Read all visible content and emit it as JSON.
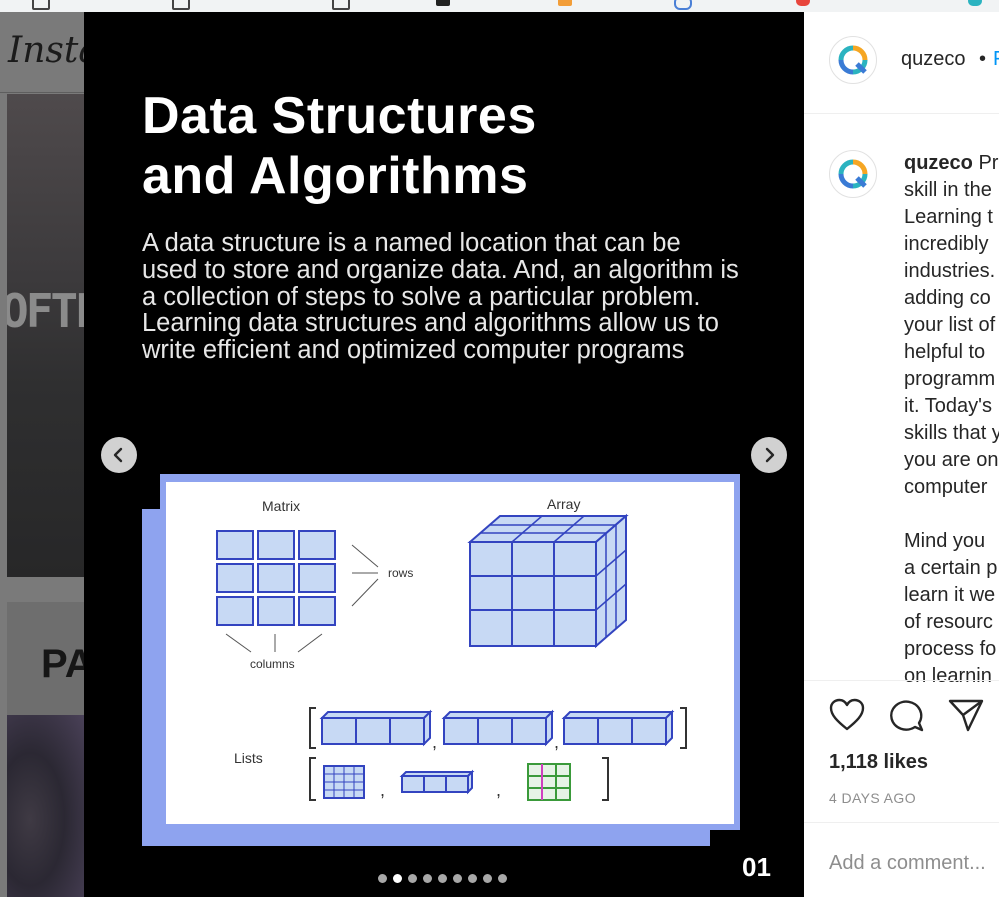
{
  "feed": {
    "logo": "Insta",
    "post1_text": "OFTE",
    "post2_text": "PA"
  },
  "slide": {
    "title": "Data Structures\nand Algorithms",
    "body": "A data structure is a named location that can be used to store and organize data. And, an algorithm is a collection of steps to solve a particular problem. Learning data structures and algorithms allow us to write efficient and optimized computer programs",
    "figure": {
      "matrix_label": "Matrix",
      "array_label": "Array",
      "rows_label": "rows",
      "columns_label": "columns",
      "lists_label": "Lists"
    },
    "number": "01",
    "dot_count": 9,
    "active_dot": 1
  },
  "post": {
    "username": "quzeco",
    "header_separator": "•",
    "follow_label": "F",
    "caption_lines": [
      "Pr",
      "skill in the",
      "Learning t",
      "incredibly",
      "industries.",
      "adding co",
      "your list of",
      "helpful to",
      "programm",
      "it. Today's",
      "skills that y",
      "you are on",
      "computer"
    ],
    "caption_p2_lines": [
      "Mind you",
      "a certain p",
      "learn it we",
      "of resourc",
      "process fo",
      "on learnin"
    ],
    "likes": "1,118 likes",
    "timestamp": "4 DAYS AGO",
    "comment_placeholder": "Add a comment..."
  },
  "colors": {
    "brand_blue": "#0095f6",
    "logo_orange": "#f5a623",
    "logo_teal": "#2bb3c0",
    "figure_frame": "#8ea3ef",
    "cell_fill": "#c7d9f4",
    "cell_border": "#3344c0"
  },
  "icons": {
    "prev": "chevron-left-icon",
    "next": "chevron-right-icon",
    "like": "heart-icon",
    "comment": "comment-icon",
    "share": "share-icon",
    "avatar": "quzeco-logo-icon"
  }
}
